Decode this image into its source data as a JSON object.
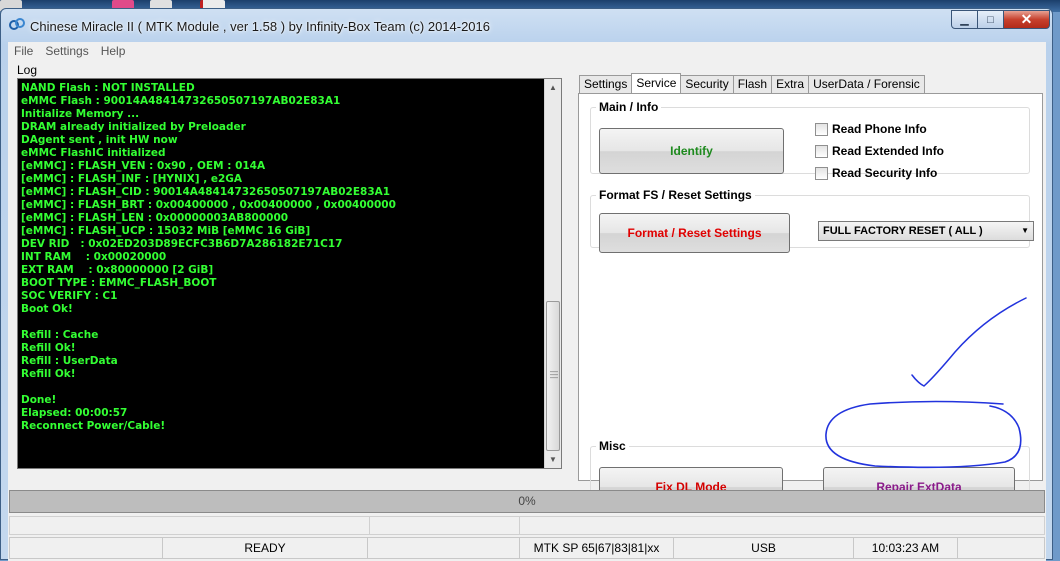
{
  "window": {
    "title": "Chinese Miracle II ( MTK Module , ver 1.58 ) by Infinity-Box Team (c) 2014-2016",
    "minimize_icon": "minimize-icon",
    "maximize_icon": "maximize-icon",
    "close_icon": "close-icon"
  },
  "menu": [
    "File",
    "Settings",
    "Help"
  ],
  "log": {
    "label": "Log",
    "text_color": "#33ff33",
    "lines": [
      "NAND Flash : NOT INSTALLED",
      "eMMC Flash : 90014A48414732650507197AB02E83A1",
      "Initialize Memory ...",
      "DRAM already initialized by Preloader",
      "DAgent sent , init HW now",
      "eMMC FlashIC initialized",
      "[eMMC] : FLASH_VEN : 0x90 , OEM : 014A",
      "[eMMC] : FLASH_INF : [HYNIX] , e2GA",
      "[eMMC] : FLASH_CID : 90014A48414732650507197AB02E83A1",
      "[eMMC] : FLASH_BRT : 0x00400000 , 0x00400000 , 0x00400000",
      "[eMMC] : FLASH_LEN : 0x00000003AB800000",
      "[eMMC] : FLASH_UCP : 15032 MiB [eMMC 16 GiB]",
      "DEV RID   : 0x02ED203D89ECFC3B6D7A286182E71C17",
      "INT RAM    : 0x00020000",
      "EXT RAM    : 0x80000000 [2 GiB]",
      "BOOT TYPE : EMMC_FLASH_BOOT",
      "SOC VERIFY : C1",
      "Boot Ok!",
      "",
      "Refill : Cache",
      "Refill Ok!",
      "Refill : UserData",
      "Refill Ok!",
      "",
      "Done!",
      "Elapsed: 00:00:57",
      "Reconnect Power/Cable!"
    ]
  },
  "tabs": {
    "items": [
      "Settings",
      "Service",
      "Security",
      "Flash",
      "Extra",
      "UserData / Forensic"
    ],
    "active": "Service"
  },
  "main_info": {
    "title": "Main / Info",
    "identify_label": "Identify",
    "identify_color": "#1e8a1e",
    "checkboxes": [
      "Read Phone Info",
      "Read Extended Info",
      "Read Security Info"
    ]
  },
  "format": {
    "title": "Format FS / Reset Settings",
    "button_label": "Format / Reset Settings",
    "button_color": "#e00000",
    "select_value": "FULL FACTORY RESET ( ALL )"
  },
  "misc": {
    "title": "Misc",
    "fix_label": "Fix DL Mode",
    "fix_color": "#d40000",
    "repair_label": "Repair ExtData",
    "repair_color": "#8a1a8a"
  },
  "progress": {
    "text": "0%",
    "value": 0
  },
  "status": {
    "state": "READY",
    "platform": "MTK SP 65|67|83|81|xx",
    "port": "USB",
    "time": "10:03:23 AM"
  },
  "annotation_color": "#2233dd"
}
